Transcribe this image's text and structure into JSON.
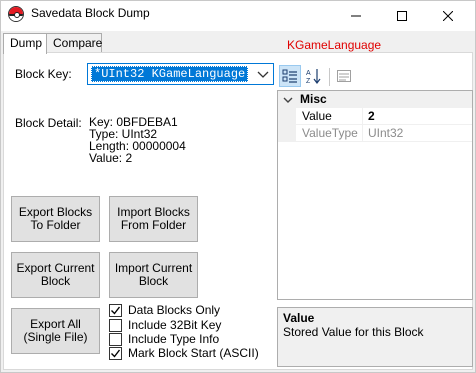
{
  "window": {
    "title": "Savedata Block Dump"
  },
  "tabs": [
    {
      "label": "Dump",
      "active": true
    },
    {
      "label": "Compare",
      "active": false
    }
  ],
  "header_note": "KGameLanguage",
  "block_key": {
    "label": "Block Key:",
    "value": "*UInt32 KGameLanguage"
  },
  "block_detail": {
    "label": "Block Detail:",
    "lines": [
      "Key: 0BFDEBA1",
      "Type: UInt32",
      "Length: 00000004",
      "Value: 2"
    ]
  },
  "buttons": {
    "export_blocks": "Export Blocks\nTo Folder",
    "import_blocks": "Import Blocks\nFrom Folder",
    "export_current": "Export Current\nBlock",
    "import_current": "Import Current\nBlock",
    "export_all": "Export All\n(Single File)"
  },
  "checkboxes": [
    {
      "label": "Data Blocks Only",
      "checked": true
    },
    {
      "label": "Include 32Bit Key",
      "checked": false
    },
    {
      "label": "Include Type Info",
      "checked": false
    },
    {
      "label": "Mark Block Start (ASCII)",
      "checked": true
    }
  ],
  "property_grid": {
    "category": "Misc",
    "rows": [
      {
        "name": "Value",
        "value": "2",
        "bold": true,
        "enabled": true
      },
      {
        "name": "ValueType",
        "value": "UInt32",
        "bold": false,
        "enabled": false
      }
    ],
    "description_title": "Value",
    "description_text": "Stored Value for this Block"
  },
  "colors": {
    "accent": "#0078d7",
    "header_note": "#e00000",
    "disabled_text": "#8c8c8c"
  },
  "icons": [
    "pokeball-icon",
    "minimize-icon",
    "maximize-icon",
    "close-icon",
    "chevron-down-icon",
    "categorized-icon",
    "alphabetical-sort-icon",
    "property-pages-icon",
    "collapse-icon"
  ]
}
